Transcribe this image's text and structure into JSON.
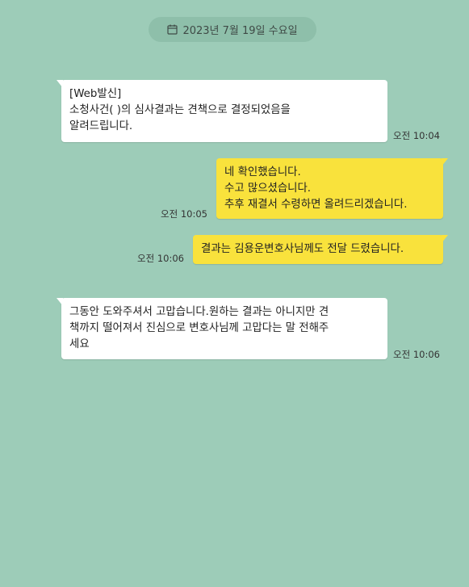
{
  "date_separator": {
    "icon": "calendar-icon",
    "text": "2023년 7월 19일 수요일"
  },
  "messages": [
    {
      "direction": "incoming",
      "lines": [
        "[Web발신]",
        "소청사건(               )의 심사결과는 견책으로 결정되었음을",
        "알려드립니다."
      ],
      "time": "오전 10:04"
    },
    {
      "direction": "outgoing",
      "lines": [
        "네 확인했습니다.",
        "수고 많으셨습니다.",
        "추후 재결서 수령하면 올려드리겠습니다."
      ],
      "time": "오전 10:05"
    },
    {
      "direction": "outgoing",
      "lines": [
        "결과는 김용운변호사님께도 전달 드렸습니다."
      ],
      "time": "오전 10:06"
    },
    {
      "direction": "incoming",
      "lines": [
        "그동안 도와주셔서 고맙습니다.원하는 결과는 아니지만 견",
        "책까지 떨어져서 진심으로 변호사님께 고맙다는 말 전해주",
        "세요"
      ],
      "time": "오전 10:06"
    }
  ],
  "colors": {
    "background": "#9dccb8",
    "incoming_bubble": "#ffffff",
    "outgoing_bubble": "#f9e23c",
    "date_pill": "#8ebfaa"
  }
}
